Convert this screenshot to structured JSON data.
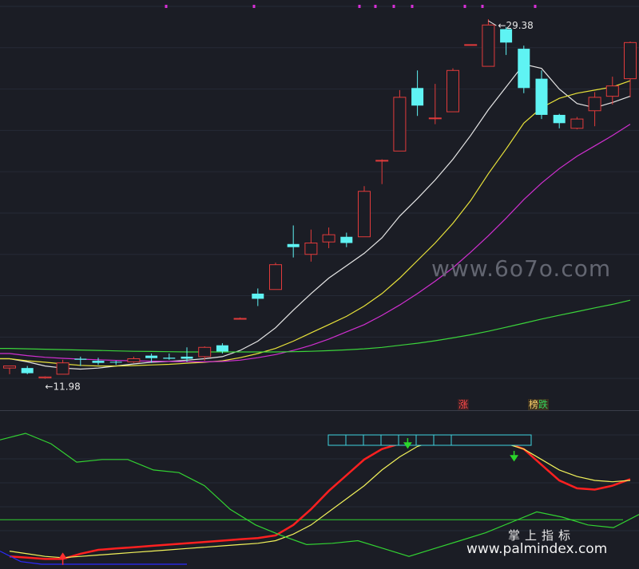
{
  "colors": {
    "background": "#1b1d25",
    "grid": "#262a36",
    "up_candle": "#e23b3b",
    "down_candle": "#5ff3f3",
    "ma_white": "#e6e6e6",
    "ma_yellow": "#e8e23a",
    "ma_magenta": "#d02fd0",
    "ma_green": "#3bd43b",
    "marker": "#d62fd6",
    "sub_red": "#ff2020",
    "sub_yellow": "#f2f25a",
    "sub_green": "#32d232",
    "sub_blue": "#2b2bff",
    "box_cyan": "#3fd4e0"
  },
  "chart_data": [
    {
      "type": "candlestick",
      "title": "",
      "annotations": {
        "high_label": "29.38",
        "low_label": "11.98"
      },
      "candles": [
        {
          "o": 12.5,
          "h": 12.6,
          "l": 12.2,
          "c": 12.6
        },
        {
          "o": 12.5,
          "h": 12.6,
          "l": 12.2,
          "c": 12.25
        },
        {
          "o": 12.02,
          "h": 12.1,
          "l": 11.98,
          "c": 12.07
        },
        {
          "o": 12.2,
          "h": 12.9,
          "l": 12.2,
          "c": 12.75
        },
        {
          "o": 12.95,
          "h": 13.05,
          "l": 12.6,
          "c": 12.9
        },
        {
          "o": 12.85,
          "h": 13.0,
          "l": 12.65,
          "c": 12.75
        },
        {
          "o": 12.8,
          "h": 12.85,
          "l": 12.65,
          "c": 12.78
        },
        {
          "o": 12.8,
          "h": 13.05,
          "l": 12.75,
          "c": 12.95
        },
        {
          "o": 13.1,
          "h": 13.2,
          "l": 12.75,
          "c": 12.98
        },
        {
          "o": 13.0,
          "h": 13.2,
          "l": 12.9,
          "c": 12.95
        },
        {
          "o": 13.05,
          "h": 13.5,
          "l": 12.8,
          "c": 12.95
        },
        {
          "o": 13.05,
          "h": 13.55,
          "l": 12.85,
          "c": 13.5
        },
        {
          "o": 13.6,
          "h": 13.7,
          "l": 13.2,
          "c": 13.3
        },
        {
          "o": 14.9,
          "h": 14.95,
          "l": 14.9,
          "c": 14.9
        },
        {
          "o": 16.1,
          "h": 16.35,
          "l": 15.5,
          "c": 15.85
        },
        {
          "o": 16.3,
          "h": 17.6,
          "l": 16.3,
          "c": 17.5
        },
        {
          "o": 18.5,
          "h": 19.4,
          "l": 17.85,
          "c": 18.35
        },
        {
          "o": 18.0,
          "h": 19.2,
          "l": 17.65,
          "c": 18.55
        },
        {
          "o": 18.6,
          "h": 19.3,
          "l": 18.3,
          "c": 18.95
        },
        {
          "o": 18.85,
          "h": 19.05,
          "l": 18.35,
          "c": 18.55
        },
        {
          "o": 18.85,
          "h": 21.3,
          "l": 18.85,
          "c": 21.05
        },
        {
          "o": 22.55,
          "h": 22.6,
          "l": 21.4,
          "c": 22.55
        },
        {
          "o": 23.0,
          "h": 25.95,
          "l": 23.0,
          "c": 25.6
        },
        {
          "o": 26.05,
          "h": 26.9,
          "l": 24.7,
          "c": 25.2
        },
        {
          "o": 24.6,
          "h": 26.25,
          "l": 24.3,
          "c": 24.6
        },
        {
          "o": 24.9,
          "h": 27.0,
          "l": 24.9,
          "c": 26.9
        },
        {
          "o": 28.15,
          "h": 28.15,
          "l": 28.15,
          "c": 28.15
        },
        {
          "o": 27.1,
          "h": 29.38,
          "l": 27.1,
          "c": 29.1
        },
        {
          "o": 28.9,
          "h": 29.0,
          "l": 27.65,
          "c": 28.25
        },
        {
          "o": 27.95,
          "h": 28.1,
          "l": 25.8,
          "c": 26.05
        },
        {
          "o": 26.5,
          "h": 26.9,
          "l": 24.55,
          "c": 24.75
        },
        {
          "o": 24.75,
          "h": 24.8,
          "l": 24.1,
          "c": 24.35
        },
        {
          "o": 24.1,
          "h": 24.65,
          "l": 24.05,
          "c": 24.55
        },
        {
          "o": 24.95,
          "h": 25.85,
          "l": 24.2,
          "c": 25.6
        },
        {
          "o": 25.65,
          "h": 26.6,
          "l": 25.25,
          "c": 26.15
        },
        {
          "o": 26.5,
          "h": 28.3,
          "l": 25.6,
          "c": 28.25
        }
      ],
      "moving_averages": [
        {
          "color_key": "ma_white",
          "values": [
            12.95,
            12.8,
            12.6,
            12.5,
            12.45,
            12.5,
            12.6,
            12.7,
            12.78,
            12.82,
            12.88,
            12.95,
            13.05,
            13.35,
            13.8,
            14.45,
            15.3,
            16.1,
            16.85,
            17.45,
            18.05,
            18.8,
            19.85,
            20.7,
            21.6,
            22.6,
            23.75,
            25.0,
            26.1,
            27.2,
            27.0,
            26.0,
            25.3,
            25.1,
            25.35,
            25.65
          ]
        },
        {
          "color_key": "ma_yellow",
          "values": [
            12.95,
            12.85,
            12.78,
            12.7,
            12.63,
            12.6,
            12.6,
            12.62,
            12.65,
            12.68,
            12.73,
            12.78,
            12.85,
            13.0,
            13.2,
            13.45,
            13.8,
            14.2,
            14.6,
            15.0,
            15.5,
            16.1,
            16.85,
            17.7,
            18.55,
            19.5,
            20.6,
            21.9,
            23.1,
            24.35,
            25.1,
            25.55,
            25.8,
            25.95,
            26.1,
            26.4
          ]
        },
        {
          "color_key": "ma_magenta",
          "values": [
            13.2,
            13.1,
            13.02,
            12.97,
            12.93,
            12.9,
            12.87,
            12.85,
            12.83,
            12.82,
            12.8,
            12.8,
            12.82,
            12.88,
            13.0,
            13.15,
            13.35,
            13.6,
            13.9,
            14.25,
            14.6,
            15.05,
            15.55,
            16.1,
            16.7,
            17.35,
            18.1,
            18.9,
            19.75,
            20.65,
            21.45,
            22.15,
            22.75,
            23.25,
            23.75,
            24.3
          ]
        },
        {
          "color_key": "ma_green",
          "values": [
            13.45,
            13.43,
            13.41,
            13.39,
            13.37,
            13.35,
            13.33,
            13.31,
            13.3,
            13.29,
            13.28,
            13.28,
            13.28,
            13.28,
            13.28,
            13.28,
            13.29,
            13.31,
            13.34,
            13.38,
            13.43,
            13.5,
            13.6,
            13.7,
            13.82,
            13.96,
            14.11,
            14.28,
            14.47,
            14.67,
            14.87,
            15.05,
            15.23,
            15.41,
            15.58,
            15.78
          ]
        }
      ],
      "y_range": [
        11.0,
        30.0
      ],
      "grid": true
    },
    {
      "type": "line",
      "title": "",
      "series": [
        {
          "color_key": "sub_red",
          "values": [
            6,
            5,
            4,
            4,
            8,
            11,
            12,
            13,
            14,
            15,
            16,
            17,
            18,
            19,
            20,
            22,
            30,
            42,
            56,
            68,
            80,
            88,
            92,
            95,
            97,
            97,
            98,
            95,
            93,
            88,
            76,
            64,
            58,
            57,
            60,
            65
          ]
        },
        {
          "color_key": "sub_yellow",
          "values": [
            10,
            8,
            6,
            5,
            6,
            7,
            8,
            9,
            10,
            11,
            12,
            13,
            14,
            15,
            16,
            18,
            23,
            30,
            40,
            50,
            60,
            72,
            82,
            90,
            94,
            96,
            96,
            94,
            92,
            88,
            80,
            72,
            67,
            64,
            63,
            64
          ]
        },
        {
          "color_key": "sub_green",
          "values": [
            95,
            100,
            92,
            78,
            80,
            80,
            72,
            70,
            60,
            42,
            30,
            22,
            15,
            16,
            18,
            12,
            6,
            12,
            18,
            24,
            32,
            40,
            36,
            30,
            28,
            38
          ]
        },
        {
          "color_key": "sub_blue",
          "values": [
            10,
            2,
            0,
            0,
            0,
            0,
            0,
            0,
            0,
            0
          ]
        }
      ],
      "reference_line": 34,
      "y_range": [
        0,
        100
      ],
      "markers": {
        "up_arrow_index": 3,
        "down_arrow_indices": [
          22,
          28
        ]
      }
    }
  ],
  "labels": {
    "tag_up": "涨",
    "tag_down_prefix": "榜",
    "tag_down_suffix": "跌",
    "watermark_main": "www.6o7o.com",
    "watermark_cn": "掌上指标",
    "watermark_url": "www.palmindex.com"
  }
}
